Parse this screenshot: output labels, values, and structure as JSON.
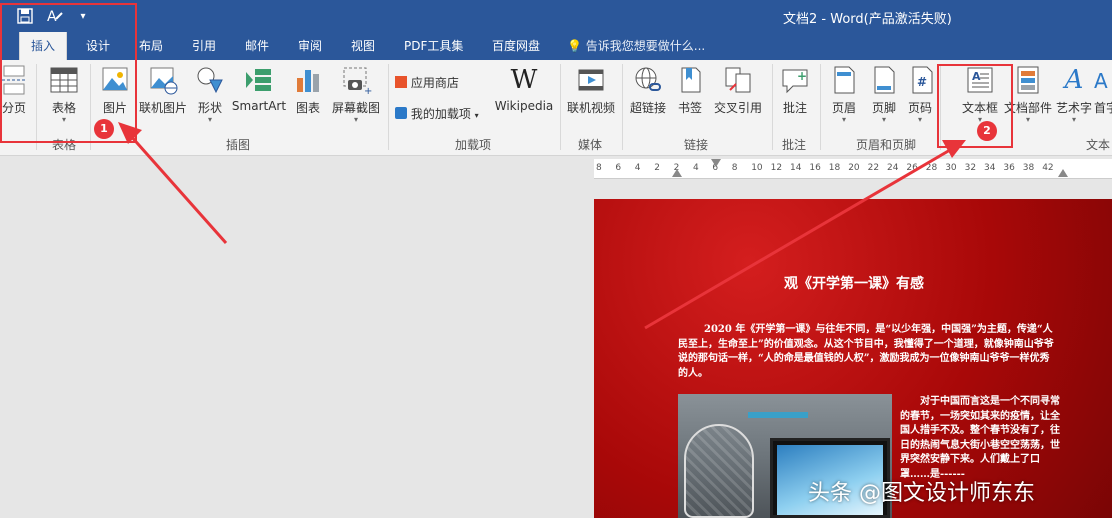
{
  "window": {
    "title": "文档2 - Word(产品激活失败)"
  },
  "quick_access": {
    "save_icon": "save-icon",
    "format_icon": "format-painter-icon",
    "dropdown_icon": "chevron-down-icon"
  },
  "tabs": [
    {
      "label": "插入",
      "active": true
    },
    {
      "label": "设计"
    },
    {
      "label": "布局"
    },
    {
      "label": "引用"
    },
    {
      "label": "邮件"
    },
    {
      "label": "审阅"
    },
    {
      "label": "视图"
    },
    {
      "label": "PDF工具集"
    },
    {
      "label": "百度网盘"
    }
  ],
  "tell_me": "告诉我您想要做什么...",
  "ribbon": {
    "page_break": "分页",
    "table": "表格",
    "picture": "图片",
    "online_picture": "联机图片",
    "shapes": "形状",
    "smartart": "SmartArt",
    "chart": "图表",
    "screenshot": "屏幕截图",
    "store": "应用商店",
    "my_addins": "我的加载项",
    "wikipedia": "Wikipedia",
    "online_video": "联机视频",
    "hyperlink": "超链接",
    "bookmark": "书签",
    "cross_ref": "交叉引用",
    "comment": "批注",
    "header": "页眉",
    "footer": "页脚",
    "page_number": "页码",
    "textbox": "文本框",
    "quick_parts": "文档部件",
    "wordart": "艺术字",
    "dropcap": "首字",
    "groups": {
      "tables": "表格",
      "illustrations": "插图",
      "addins": "加载项",
      "media": "媒体",
      "links": "链接",
      "comments": "批注",
      "header_footer": "页眉和页脚",
      "text": "文本"
    }
  },
  "ruler": {
    "numbers": [
      "8",
      "6",
      "4",
      "2",
      "2",
      "4",
      "6",
      "8",
      "10",
      "12",
      "14",
      "16",
      "18",
      "20",
      "22",
      "24",
      "26",
      "28",
      "30",
      "32",
      "34",
      "36",
      "38",
      "42"
    ]
  },
  "document": {
    "heading": "观《开学第一课》有感",
    "para1": "2020 年《开学第一课》与往年不同，是“以少年强，中国强”为主题，传递“人民至上，生命至上”的价值观念。从这个节目中，我懂得了一个道理，就像钟南山爷爷说的那句话一样，“人的命是最值钱的人权”，激励我成为一位像钟南山爷爷一样优秀的人。",
    "para2": "对于中国而言这是一个不同寻常的春节，一场突如其来的疫情，让全国人措手不及。整个春节没有了，往日的热闹气息大街小巷空空荡荡，世界突然安静下来。人们戴上了口罩……是------"
  },
  "annotations": {
    "badge1": "1",
    "badge2": "2",
    "color": "#e8343a"
  },
  "watermark": "头条 @图文设计师东东"
}
